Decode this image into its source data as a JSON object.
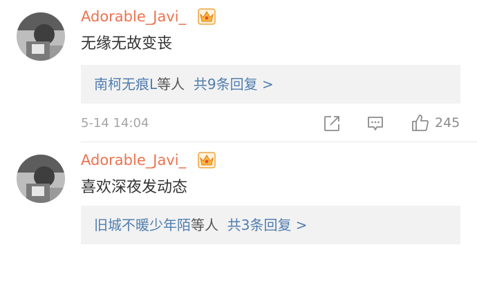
{
  "comments": [
    {
      "username": "Adorable_Javi_",
      "text": "无缘无故变丧",
      "reply_users": "南柯无痕L",
      "reply_sep": "等人",
      "reply_count": "共9条回复 >",
      "time": "5-14 14:04",
      "likes": "245"
    },
    {
      "username": "Adorable_Javi_",
      "text": "喜欢深夜发动态",
      "reply_users": "旧城不暖少年陌",
      "reply_sep": "等人",
      "reply_count": "共3条回复 >"
    }
  ],
  "icons": {
    "crown": "crown-badge-icon",
    "share": "share-icon",
    "comment": "comment-icon",
    "like": "like-icon"
  },
  "colors": {
    "username": "#eb7350",
    "link": "#507daf",
    "reply_bg": "#f2f2f2",
    "meta": "#a5a5a5"
  }
}
